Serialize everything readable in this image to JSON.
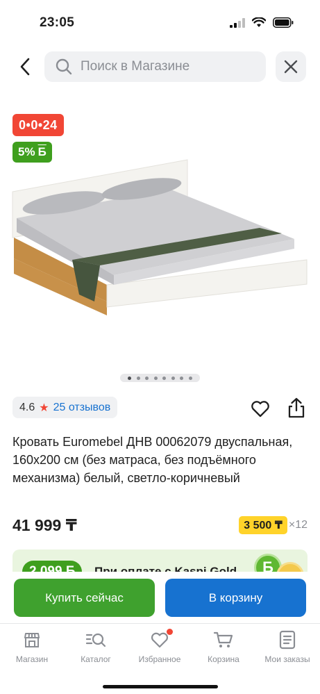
{
  "status": {
    "time": "23:05"
  },
  "search": {
    "placeholder": "Поиск в Магазине"
  },
  "badges": {
    "timer": "0•0•24",
    "bonus_percent": "5%",
    "bonus_symbol": "Б"
  },
  "gallery": {
    "slides": 8,
    "active_slide": 1
  },
  "rating": {
    "score": "4.6",
    "reviews": "25 отзывов"
  },
  "product": {
    "title": "Кровать Euromebel ДНВ 00062079 двуспальная, 160x200 см (без матраса, без подъёмного механизма) белый, светло-коричневый",
    "price": "41 999 ₸",
    "credit_amount": "3 500 ₸",
    "credit_months": "×12"
  },
  "promo": {
    "bonus": "2 099 Б",
    "text": "При оплате с Kaspi Gold",
    "coin_symbol": "Б"
  },
  "actions": {
    "buy_now": "Купить сейчас",
    "add_to_cart": "В корзину"
  },
  "tabs": [
    {
      "label": "Магазин",
      "icon": "store-icon"
    },
    {
      "label": "Каталог",
      "icon": "catalog-search-icon"
    },
    {
      "label": "Избранное",
      "icon": "heart-icon"
    },
    {
      "label": "Корзина",
      "icon": "cart-icon"
    },
    {
      "label": "Мои заказы",
      "icon": "orders-icon"
    }
  ],
  "colors": {
    "accent_blue": "#1772d0",
    "accent_green": "#3fa12e",
    "timer_red": "#f14635",
    "credit_yellow": "#ffd32a"
  }
}
